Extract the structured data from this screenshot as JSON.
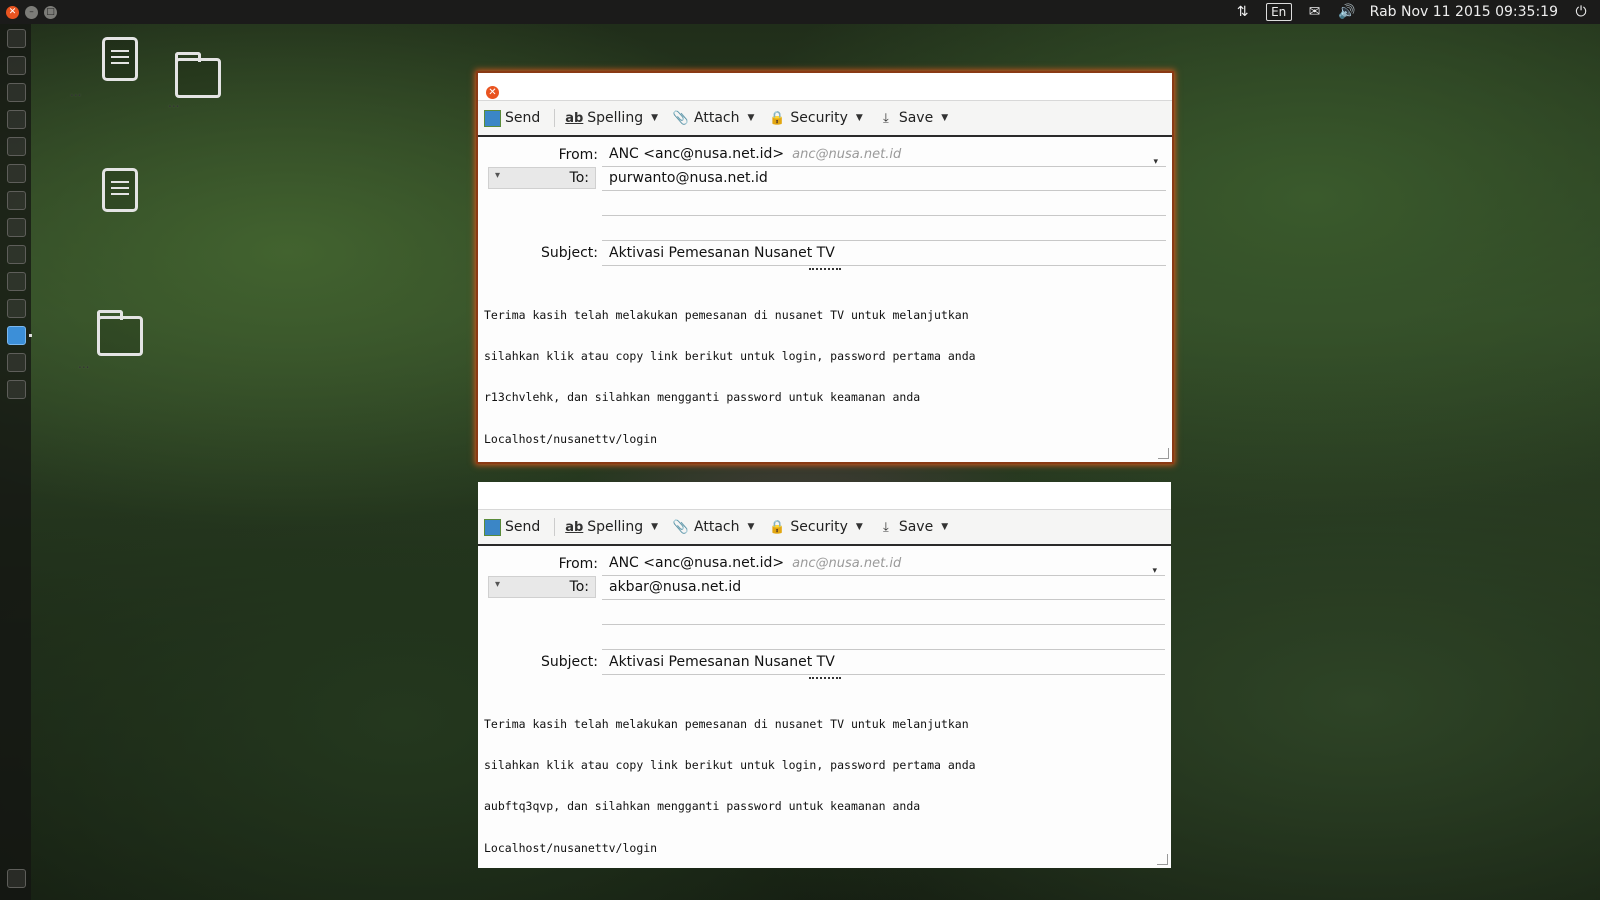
{
  "panel": {
    "language": "En",
    "clock": "Rab Nov 11 2015 09:35:19"
  },
  "desktop": {
    "icons": [
      {
        "label": "...",
        "kind": "document"
      },
      {
        "label": "...",
        "kind": "folder"
      },
      {
        "label": "",
        "kind": "document"
      },
      {
        "label": "...",
        "kind": "folder"
      }
    ]
  },
  "windows": [
    {
      "toolbar": {
        "send": "Send",
        "spelling": "Spelling",
        "attach": "Attach",
        "security": "Security",
        "save": "Save"
      },
      "labels": {
        "from": "From:",
        "to": "To:",
        "subject": "Subject:"
      },
      "from_value": "ANC <anc@nusa.net.id>",
      "from_hint": "anc@nusa.net.id",
      "to_value": "purwanto@nusa.net.id",
      "subject_value": "Aktivasi Pemesanan Nusanet TV",
      "body": [
        "Terima kasih telah melakukan pemesanan di nusanet TV untuk melanjutkan",
        "silahkan klik atau copy link berikut untuk login, password pertama anda",
        "r13chvlehk, dan silahkan mengganti password untuk keamanan anda",
        "Localhost/nusanettv/login"
      ]
    },
    {
      "toolbar": {
        "send": "Send",
        "spelling": "Spelling",
        "attach": "Attach",
        "security": "Security",
        "save": "Save"
      },
      "labels": {
        "from": "From:",
        "to": "To:",
        "subject": "Subject:"
      },
      "from_value": "ANC <anc@nusa.net.id>",
      "from_hint": "anc@nusa.net.id",
      "to_value": "akbar@nusa.net.id",
      "subject_value": "Aktivasi Pemesanan Nusanet TV",
      "body": [
        "Terima kasih telah melakukan pemesanan di nusanet TV untuk melanjutkan",
        "silahkan klik atau copy link berikut untuk login, password pertama anda",
        "aubftq3qvp, dan silahkan mengganti password untuk keamanan anda",
        "Localhost/nusanettv/login"
      ]
    }
  ]
}
